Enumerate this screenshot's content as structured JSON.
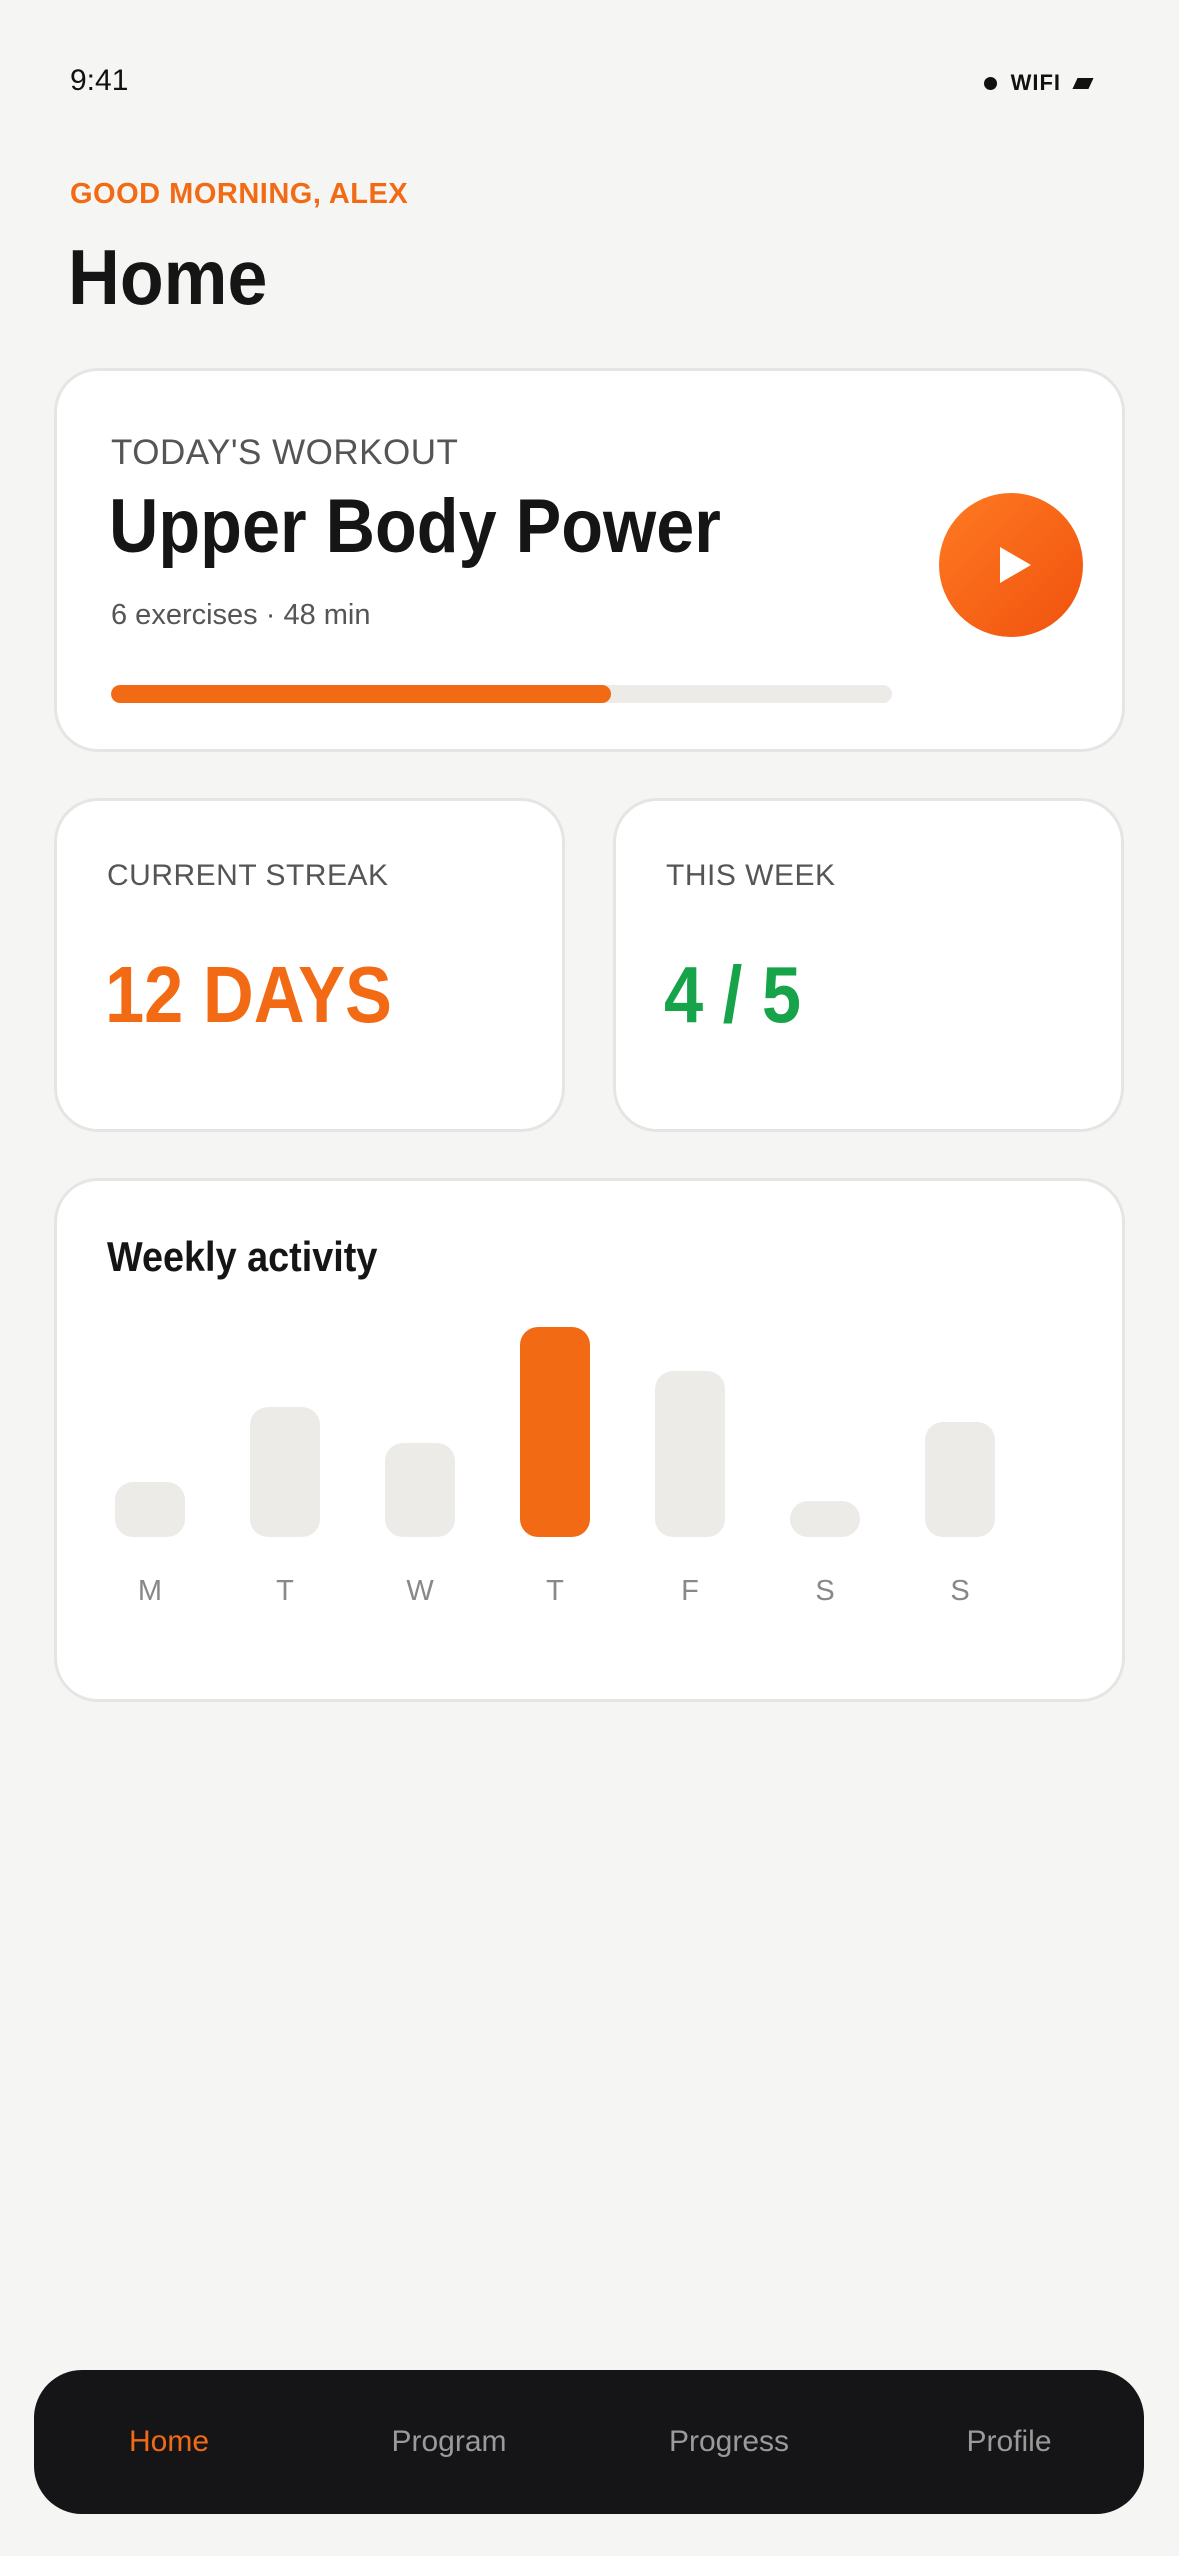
{
  "status_bar": {
    "time": "9:41",
    "wifi_label": "WIFI"
  },
  "header": {
    "greeting": "GOOD MORNING, ALEX",
    "title": "Home"
  },
  "workout": {
    "label": "TODAY'S WORKOUT",
    "title": "Upper Body Power",
    "meta": "6 exercises · 48 min",
    "progress_percent": 64,
    "play_icon": "play-icon"
  },
  "stats": {
    "streak": {
      "label": "CURRENT STREAK",
      "value": "12 DAYS"
    },
    "week": {
      "label": "THIS WEEK",
      "value": "4 / 5"
    }
  },
  "activity": {
    "title": "Weekly activity",
    "days": [
      {
        "label": "M",
        "level": 0.26,
        "active": false
      },
      {
        "label": "T",
        "level": 0.62,
        "active": false
      },
      {
        "label": "W",
        "level": 0.45,
        "active": false
      },
      {
        "label": "T",
        "level": 1.0,
        "active": true
      },
      {
        "label": "F",
        "level": 0.79,
        "active": false
      },
      {
        "label": "S",
        "level": 0.17,
        "active": false
      },
      {
        "label": "S",
        "level": 0.55,
        "active": false
      }
    ]
  },
  "tabs": [
    {
      "label": "Home",
      "active": true
    },
    {
      "label": "Program",
      "active": false
    },
    {
      "label": "Progress",
      "active": false
    },
    {
      "label": "Profile",
      "active": false
    }
  ],
  "colors": {
    "accent": "#f26a14",
    "success": "#16a34a",
    "tabbar": "#151517"
  }
}
